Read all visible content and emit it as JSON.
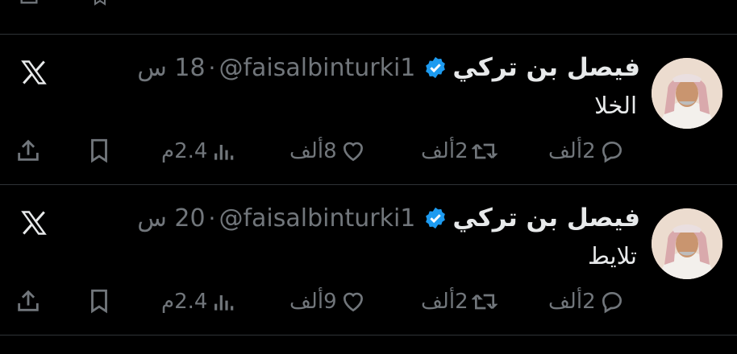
{
  "tweets": [
    {
      "name": "فيصل بن تركي",
      "handle": "@faisalbinturki1",
      "dot": "·",
      "time": "18 س",
      "text": "الخلا",
      "replies": "2ألف",
      "retweets": "2ألف",
      "likes": "8ألف",
      "views": "2.4م"
    },
    {
      "name": "فيصل بن تركي",
      "handle": "@faisalbinturki1",
      "dot": "·",
      "time": "20 س",
      "text": "تلايط",
      "replies": "2ألف",
      "retweets": "2ألف",
      "likes": "9ألف",
      "views": "2.4م"
    }
  ],
  "icons": {
    "reply": "reply-icon",
    "retweet": "retweet-icon",
    "like": "heart-icon",
    "views": "views-icon",
    "bookmark": "bookmark-icon",
    "share": "share-icon",
    "verified": "verified-badge-icon",
    "brand": "x-logo-icon"
  },
  "colors": {
    "background": "#000000",
    "text": "#e7e9ea",
    "muted": "#71767b",
    "verified": "#1d9bf0",
    "divider": "#2f3336"
  }
}
